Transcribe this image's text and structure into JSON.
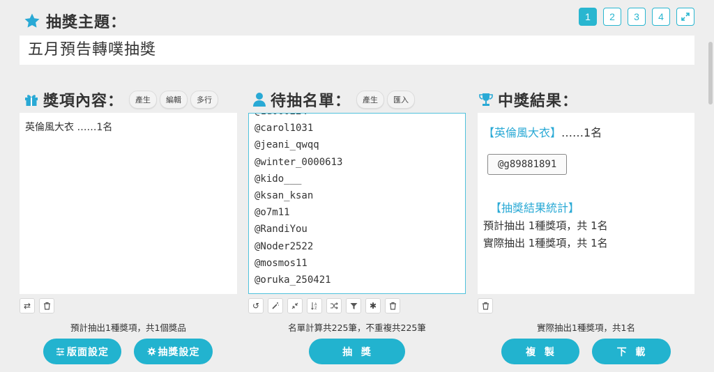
{
  "topic": {
    "label": "抽獎主題：",
    "value": "五月預告轉噗抽獎"
  },
  "pages": [
    "1",
    "2",
    "3",
    "4"
  ],
  "prizes": {
    "label": "獎項內容：",
    "buttons": [
      "產生",
      "編輯",
      "多行"
    ],
    "content": "英倫風大衣 ……1名",
    "summary": "預計抽出1種獎項，共1個獎品",
    "actions": [
      "版面設定",
      "抽獎設定"
    ]
  },
  "candidates": {
    "label": "待抽名單：",
    "buttons": [
      "產生",
      "匯入"
    ],
    "names": [
      "@carol1031",
      "@jeani_qwqq",
      "@winter_0000613",
      "@kido___",
      "@ksan_ksan",
      "@o7m11",
      "@RandiYou",
      "@Noder2522",
      "@mosmos11",
      "@oruka_250421"
    ],
    "summary": "名單計算共225筆，不重複共225筆",
    "draw_label": "抽  獎"
  },
  "results": {
    "label": "中獎結果：",
    "prize_title": "【英倫風大衣】",
    "prize_count": "……1名",
    "winner": "@g89881891",
    "stats_title": "【抽獎結果統計】",
    "stats_lines": [
      "預計抽出 1種獎項，共 1名",
      "實際抽出 1種獎項，共 1名"
    ],
    "summary": "實際抽出1種獎項，共1名",
    "copy_label": "複  製",
    "download_label": "下  載"
  },
  "colors": {
    "accent": "#29b6d0",
    "button": "#22b3cf",
    "heading_blue": "#29a9d5"
  }
}
